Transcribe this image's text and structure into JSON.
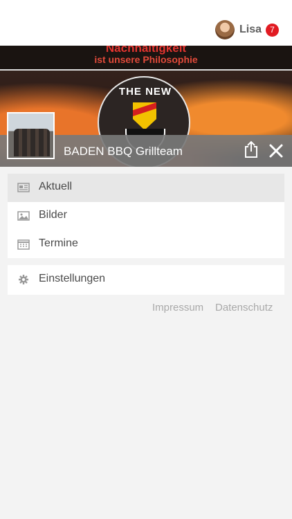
{
  "user": {
    "name": "Lisa",
    "notification_count": "7"
  },
  "banner": {
    "slogan_line1": "Nachhaltigkeit",
    "slogan_line2": "ist unsere Philosophie",
    "logo_text": "THE NEW"
  },
  "team": {
    "name": "BADEN BBQ Grillteam"
  },
  "menu": {
    "items": [
      {
        "label": "Aktuell",
        "icon": "newspaper-icon",
        "active": true
      },
      {
        "label": "Bilder",
        "icon": "image-icon",
        "active": false
      },
      {
        "label": "Termine",
        "icon": "calendar-icon",
        "active": false
      }
    ],
    "settings": {
      "label": "Einstellungen",
      "icon": "gear-icon"
    }
  },
  "footer": {
    "impressum": "Impressum",
    "datenschutz": "Datenschutz"
  },
  "colors": {
    "badge": "#e11b22",
    "title_bar": "#787878",
    "active_item": "#e7e7e7"
  }
}
